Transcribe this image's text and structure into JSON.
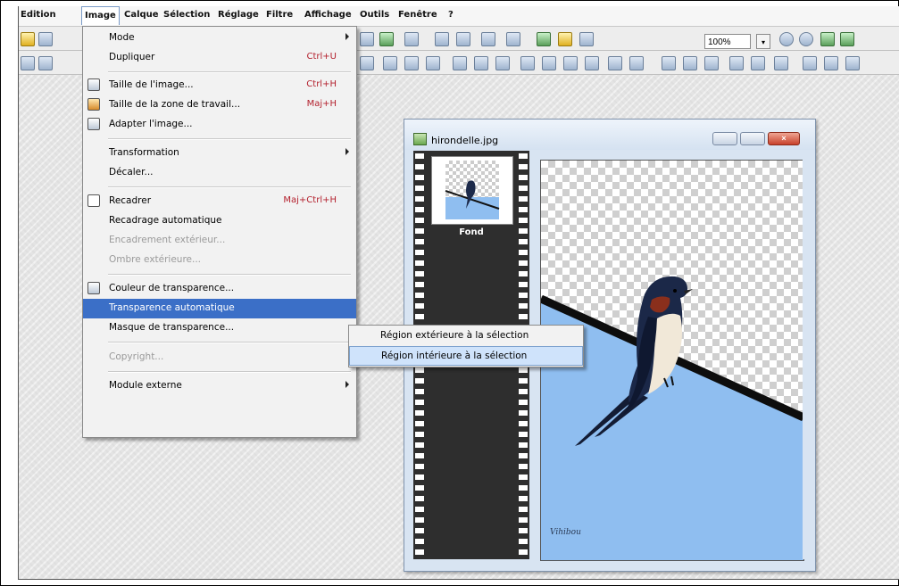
{
  "menubar": {
    "items": [
      "Edition",
      "Image",
      "Calque",
      "Sélection",
      "Réglage",
      "Filtre",
      "Affichage",
      "Outils",
      "Fenêtre",
      "?"
    ],
    "active": "Image"
  },
  "toolbar": {
    "zoom_value": "100%",
    "zoom_dropdown_glyph": "▾"
  },
  "image_menu": {
    "items": [
      {
        "label": "Mode",
        "shortcut": "",
        "submenu": true,
        "disabled": false,
        "icon": ""
      },
      {
        "label": "Dupliquer",
        "shortcut": "Ctrl+U",
        "submenu": false,
        "disabled": false,
        "icon": ""
      },
      {
        "label": "Taille de l'image...",
        "shortcut": "Ctrl+H",
        "submenu": false,
        "disabled": false,
        "icon": "resize-icon"
      },
      {
        "label": "Taille de la zone de travail...",
        "shortcut": "Maj+H",
        "submenu": false,
        "disabled": false,
        "icon": "canvas-size-icon"
      },
      {
        "label": "Adapter l'image...",
        "shortcut": "",
        "submenu": false,
        "disabled": false,
        "icon": "fit-image-icon"
      },
      {
        "label": "Transformation",
        "shortcut": "",
        "submenu": true,
        "disabled": false,
        "icon": ""
      },
      {
        "label": "Décaler...",
        "shortcut": "",
        "submenu": false,
        "disabled": false,
        "icon": ""
      },
      {
        "label": "Recadrer",
        "shortcut": "Maj+Ctrl+H",
        "submenu": false,
        "disabled": false,
        "icon": "crop-icon"
      },
      {
        "label": "Recadrage automatique",
        "shortcut": "",
        "submenu": false,
        "disabled": false,
        "icon": ""
      },
      {
        "label": "Encadrement extérieur...",
        "shortcut": "",
        "submenu": false,
        "disabled": true,
        "icon": ""
      },
      {
        "label": "Ombre extérieure...",
        "shortcut": "",
        "submenu": false,
        "disabled": true,
        "icon": ""
      },
      {
        "label": "Couleur de transparence...",
        "shortcut": "",
        "submenu": false,
        "disabled": false,
        "icon": "transparency-color-icon"
      },
      {
        "label": "Transparence automatique",
        "shortcut": "",
        "submenu": true,
        "disabled": false,
        "icon": ""
      },
      {
        "label": "Masque de transparence...",
        "shortcut": "",
        "submenu": false,
        "disabled": false,
        "icon": ""
      },
      {
        "label": "Copyright...",
        "shortcut": "",
        "submenu": false,
        "disabled": true,
        "icon": ""
      },
      {
        "label": "Module externe",
        "shortcut": "",
        "submenu": true,
        "disabled": false,
        "icon": ""
      }
    ],
    "highlighted": "Transparence automatique"
  },
  "submenu": {
    "items": [
      "Région extérieure à la sélection",
      "Région intérieure à la sélection"
    ],
    "highlighted": "Région intérieure à la sélection"
  },
  "image_window": {
    "title": "hirondelle.jpg",
    "layer_name": "Fond",
    "close_glyph": "×",
    "signature": "Vihibou"
  },
  "colors": {
    "menu_highlight": "#3b6fc7",
    "submenu_highlight": "#cfe3fb",
    "sky": "#8fbef0",
    "shortcut_text": "#b3202d"
  }
}
